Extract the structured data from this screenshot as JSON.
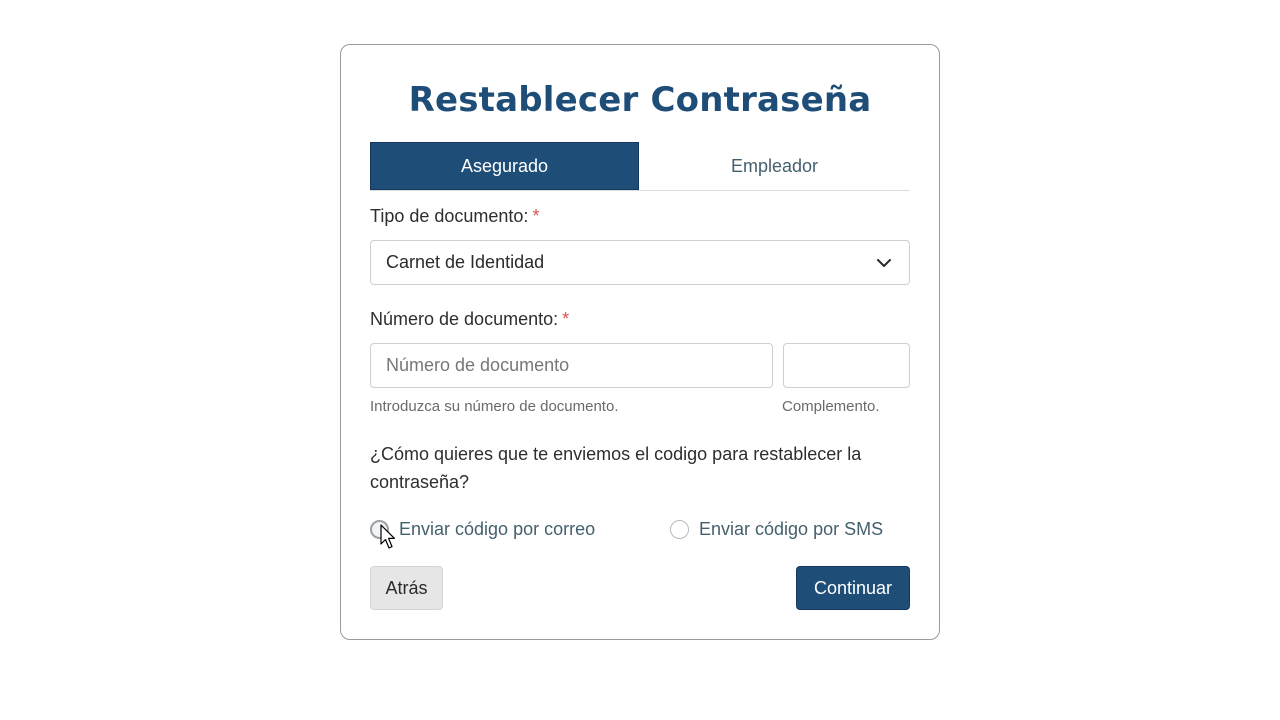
{
  "form": {
    "title": "Restablecer Contraseña",
    "tabs": [
      {
        "label": "Asegurado",
        "active": true
      },
      {
        "label": "Empleador",
        "active": false
      }
    ],
    "document_type": {
      "label": "Tipo de documento:",
      "required_mark": "*",
      "selected": "Carnet de Identidad"
    },
    "document_number": {
      "label": "Número de documento:",
      "required_mark": "*",
      "placeholder": "Número de documento",
      "value": "",
      "help": "Introduzca su número de documento."
    },
    "complement": {
      "placeholder": "",
      "value": "",
      "help": "Complemento."
    },
    "question": "¿Cómo quieres que te enviemos el codigo para restablecer la contraseña?",
    "options": [
      {
        "label": "Enviar código por correo",
        "selected": false
      },
      {
        "label": "Enviar código por SMS",
        "selected": false
      }
    ],
    "buttons": {
      "back": "Atrás",
      "continue": "Continuar"
    }
  },
  "colors": {
    "primary": "#1e4d78",
    "required": "#d9534f",
    "border": "#cfcfcf"
  },
  "icons": {
    "select": "chevron-down-icon",
    "pointer": "mouse-pointer-icon"
  }
}
